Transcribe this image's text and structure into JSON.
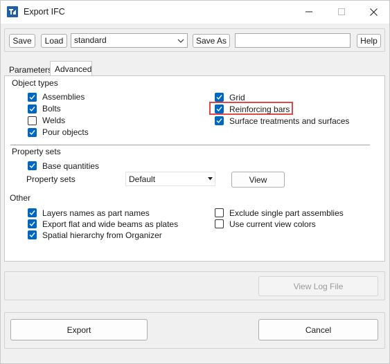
{
  "window": {
    "title": "Export IFC",
    "colors": {
      "accent": "#0067c0",
      "highlight": "#e04848",
      "titlebar": "#ffffff",
      "background": "#f0f0f0"
    }
  },
  "toolbar": {
    "save_label": "Save",
    "load_label": "Load",
    "preset_value": "standard",
    "save_as_label": "Save As",
    "save_as_value": "",
    "help_label": "Help"
  },
  "tabs": [
    {
      "label": "Parameters",
      "active": false
    },
    {
      "label": "Advanced",
      "active": true
    }
  ],
  "object_types": {
    "heading": "Object types",
    "items": [
      {
        "label": "Assemblies",
        "checked": true
      },
      {
        "label": "Bolts",
        "checked": true
      },
      {
        "label": "Welds",
        "checked": false
      },
      {
        "label": "Pour objects",
        "checked": true
      },
      {
        "label": "Grid",
        "checked": true
      },
      {
        "label": "Reinforcing bars",
        "checked": true
      },
      {
        "label": "Surface treatments and surfaces",
        "checked": true
      }
    ]
  },
  "property_sets": {
    "heading": "Property sets",
    "base_quantities": {
      "label": "Base quantities",
      "checked": true
    },
    "row_label": "Property sets",
    "selected": "Default",
    "view_label": "View"
  },
  "other": {
    "heading": "Other",
    "items": [
      {
        "label": "Layers names as part names",
        "checked": true
      },
      {
        "label": "Export flat and wide beams as plates",
        "checked": true
      },
      {
        "label": "Spatial hierarchy from Organizer",
        "checked": true
      },
      {
        "label": "Exclude single part assemblies",
        "checked": false
      },
      {
        "label": "Use current view colors",
        "checked": false
      }
    ]
  },
  "log": {
    "view_log_label": "View Log File"
  },
  "actions": {
    "export_label": "Export",
    "cancel_label": "Cancel"
  }
}
